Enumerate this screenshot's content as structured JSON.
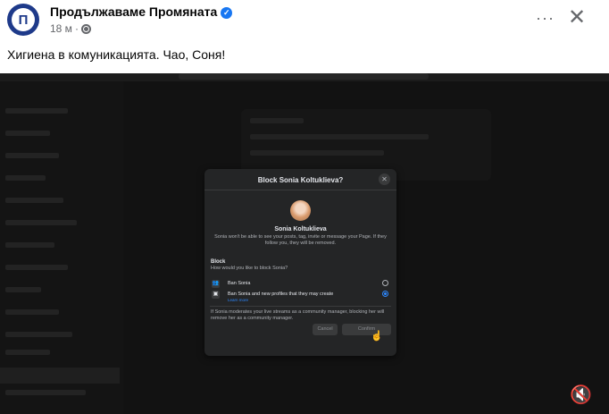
{
  "post": {
    "page_name": "Продължаваме Промяната",
    "verified_badge_icon": "verified-check-icon",
    "avatar_letter": "П",
    "time": "18 м",
    "dot": "·",
    "privacy_icon": "globe-icon",
    "more_icon": "more-dots-icon",
    "more_label": "···",
    "close_icon": "close-x-icon",
    "close_label": "✕",
    "text": "Хигиена в комуникацията. Чао, Соня!"
  },
  "video": {
    "mute_icon": "speaker-muted-icon",
    "mute_label": "🔇",
    "modal": {
      "title": "Block Sonia Koltuklieva?",
      "close_label": "✕",
      "name": "Sonia Koltuklieva",
      "description": "Sonia won't be able to see your posts, tag, invite or message your Page. If they follow you, they will be removed.",
      "block_heading": "Block",
      "block_question": "How would you like to block Sonia?",
      "options": [
        {
          "label": "Ban Sonia",
          "icon": "ban-user-icon",
          "selected": false
        },
        {
          "label": "Ban Sonia and new profiles that they may create",
          "link": "Learn more",
          "icon": "ban-profiles-icon",
          "selected": true
        }
      ],
      "note": "If Sonia moderates your live streams as a community manager, blocking her will remove her as a community manager.",
      "cancel_label": "Cancel",
      "confirm_label": "Confirm"
    }
  }
}
